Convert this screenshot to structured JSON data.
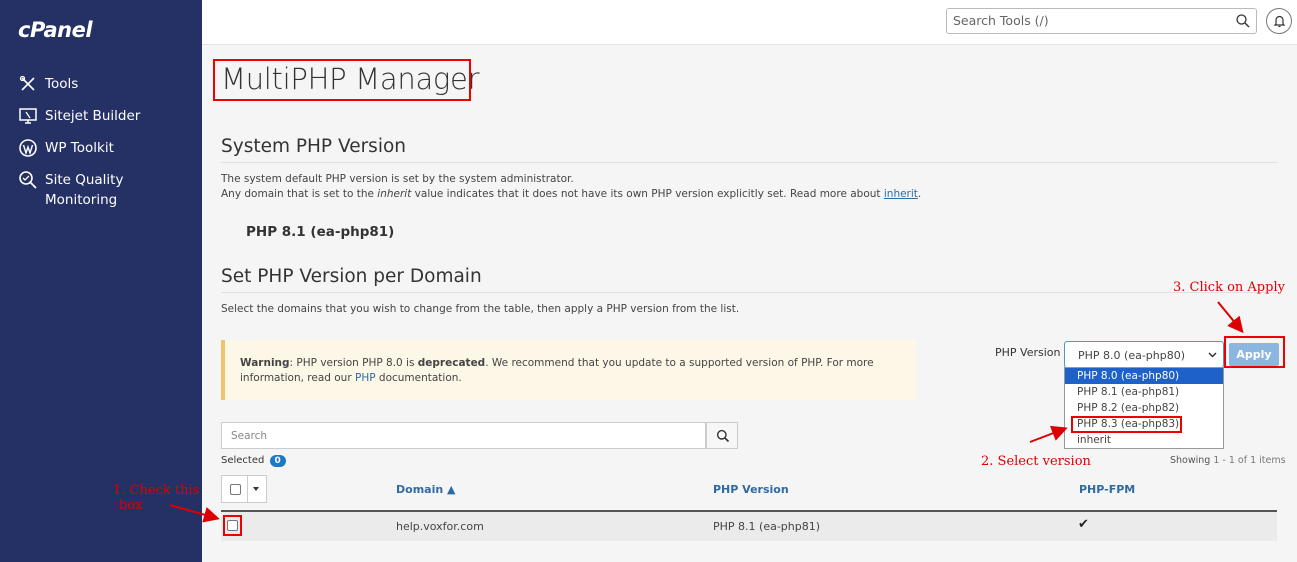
{
  "sidebar": {
    "logo": "cPanel",
    "items": [
      {
        "label": "Tools",
        "icon": "tools-icon"
      },
      {
        "label": "Sitejet Builder",
        "icon": "monitor-icon"
      },
      {
        "label": "WP Toolkit",
        "icon": "wordpress-icon"
      },
      {
        "label": "Site Quality",
        "label2": "Monitoring",
        "icon": "search-quality-icon"
      }
    ],
    "bg_color": "#253065"
  },
  "topbar": {
    "search_placeholder": "Search Tools (/)"
  },
  "page": {
    "title": "MultiPHP Manager"
  },
  "system_php": {
    "heading": "System PHP Version",
    "desc1": "The system default PHP version is set by the system administrator.",
    "desc2_pre": "Any domain that is set to the ",
    "desc2_em": "inherit",
    "desc2_mid": " value indicates that it does not have its own PHP version explicitly set. Read more about ",
    "desc2_link": "inherit",
    "desc2_end": ".",
    "version": "PHP 8.1 (ea-php81)"
  },
  "per_domain": {
    "heading": "Set PHP Version per Domain",
    "desc": "Select the domains that you wish to change from the table, then apply a PHP version from the list."
  },
  "warning": {
    "label": "Warning",
    "text1": ": PHP version PHP 8.0 is ",
    "bold": "deprecated",
    "text2": ". We recommend that you update to a supported version of PHP. For more",
    "text3": "information, read our ",
    "link": "PHP",
    "text4": " documentation."
  },
  "php_version_control": {
    "label": "PHP Version",
    "selected": "PHP 8.0 (ea-php80)",
    "apply_label": "Apply",
    "options": [
      {
        "label": "PHP 8.0 (ea-php80)",
        "highlighted": true
      },
      {
        "label": "PHP 8.1 (ea-php81)",
        "highlighted": false
      },
      {
        "label": "PHP 8.2 (ea-php82)",
        "highlighted": false
      },
      {
        "label": "PHP 8.3 (ea-php83)",
        "highlighted": false
      },
      {
        "label": "inherit",
        "highlighted": false
      }
    ]
  },
  "table": {
    "search_placeholder": "Search",
    "selected_label": "Selected",
    "selected_count": "0",
    "showing_label": "Showing ",
    "showing_range": "1 - 1 of 1 items",
    "columns": {
      "domain": "Domain ▲",
      "php_version": "PHP Version",
      "php_fpm": "PHP-FPM"
    },
    "rows": [
      {
        "domain": "help.voxfor.com",
        "php_version": "PHP 8.1 (ea-php81)",
        "php_fpm": "✔"
      }
    ]
  },
  "annotations": {
    "step1_line1": "1. Check this",
    "step1_line2": "box",
    "step2": "2. Select version",
    "step3": "3. Click on Apply",
    "color": "#dd0000"
  }
}
